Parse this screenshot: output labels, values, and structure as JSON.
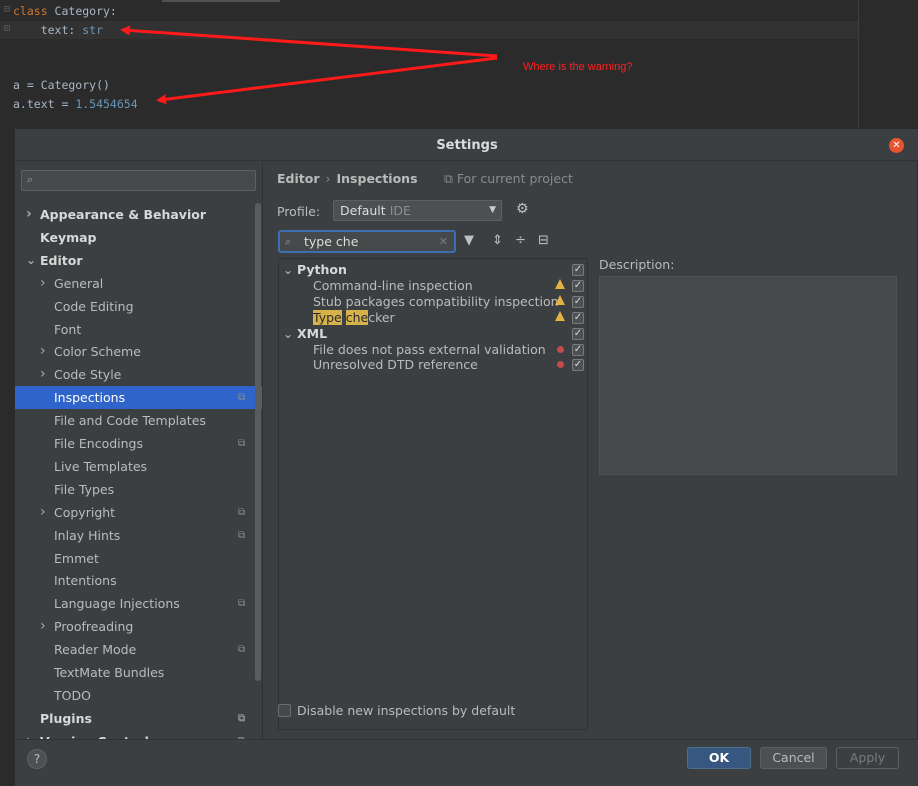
{
  "editor": {
    "lines": [
      {
        "kw": "class",
        "rest": " Category:"
      },
      {
        "plain": "    text: ",
        "typed": "str"
      },
      {
        "plain": "a = Category()"
      },
      {
        "plain": "a.text = ",
        "num": "1.5454654"
      }
    ],
    "annotation": "Where is the warning?"
  },
  "dialog": {
    "title": "Settings",
    "close_icon": "close-icon",
    "colors": {
      "accent": "#2f65ca",
      "warning": "#e3b341",
      "error": "#c74a4a",
      "annotation": "#ff2020"
    }
  },
  "sidebar": {
    "search_placeholder": "",
    "items": [
      {
        "label": "Appearance & Behavior",
        "bold": true,
        "chevron": true
      },
      {
        "label": "Keymap",
        "bold": true
      },
      {
        "label": "Editor",
        "bold": true,
        "expanded": true
      },
      {
        "label": "General",
        "chevron": true
      },
      {
        "label": "Code Editing"
      },
      {
        "label": "Font"
      },
      {
        "label": "Color Scheme",
        "chevron": true
      },
      {
        "label": "Code Style",
        "chevron": true
      },
      {
        "label": "Inspections",
        "selected": true,
        "project": true
      },
      {
        "label": "File and Code Templates"
      },
      {
        "label": "File Encodings",
        "project": true
      },
      {
        "label": "Live Templates"
      },
      {
        "label": "File Types"
      },
      {
        "label": "Copyright",
        "chevron": true,
        "project": true
      },
      {
        "label": "Inlay Hints",
        "project": true
      },
      {
        "label": "Emmet"
      },
      {
        "label": "Intentions"
      },
      {
        "label": "Language Injections",
        "project": true
      },
      {
        "label": "Proofreading",
        "chevron": true
      },
      {
        "label": "Reader Mode",
        "project": true
      },
      {
        "label": "TextMate Bundles"
      },
      {
        "label": "TODO"
      },
      {
        "label": "Plugins",
        "bold": true,
        "project": true
      },
      {
        "label": "Version Control",
        "bold": true,
        "chevron": true,
        "project": true
      }
    ]
  },
  "pane": {
    "breadcrumb": [
      "Editor",
      "Inspections"
    ],
    "for_project": "For current project",
    "profile_label": "Profile:",
    "profile_value": "Default",
    "profile_sub": "IDE",
    "filter_value": "type che",
    "tree": [
      {
        "label": "Python",
        "group": true
      },
      {
        "label": "Command-line inspection",
        "severity": "warning"
      },
      {
        "label": "Stub packages compatibility inspection",
        "severity": "warning"
      },
      {
        "label_hl1": "Type",
        "label_mid": " ",
        "label_hl2": "che",
        "label_rest": "cker",
        "severity": "warning"
      },
      {
        "label": "XML",
        "group": true
      },
      {
        "label": "File does not pass external validation",
        "severity": "error"
      },
      {
        "label": "Unresolved DTD reference",
        "severity": "error"
      }
    ],
    "description_label": "Description:",
    "disable_label": "Disable new inspections by default"
  },
  "footer": {
    "help": "?",
    "ok": "OK",
    "cancel": "Cancel",
    "apply": "Apply"
  }
}
